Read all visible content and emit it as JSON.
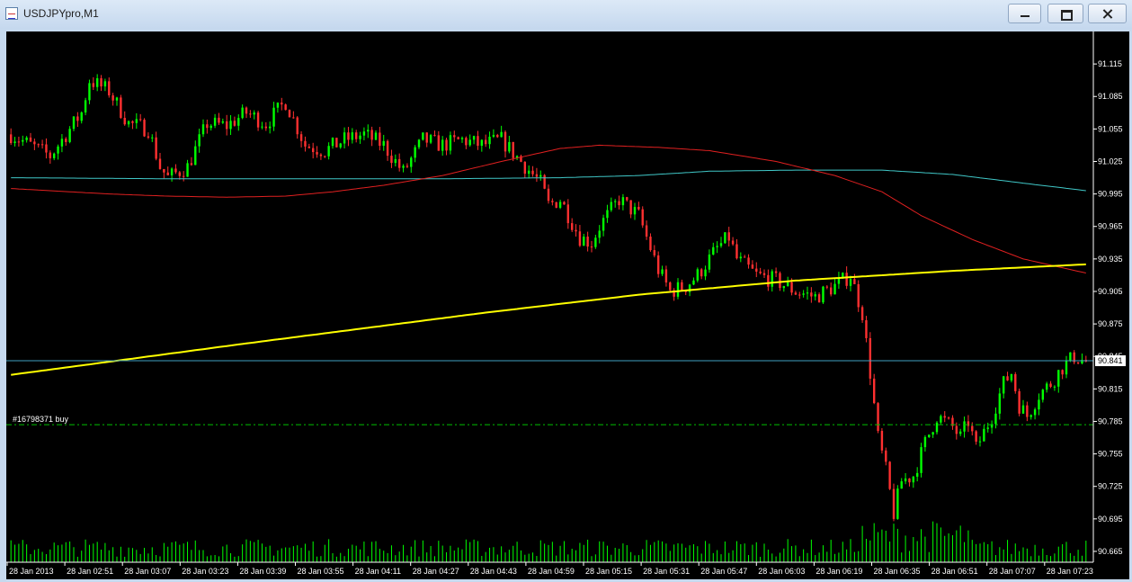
{
  "window": {
    "title": "USDJPYpro,M1",
    "minimize": "minimize",
    "maximize": "maximize",
    "close": "close"
  },
  "colors": {
    "background": "#000000",
    "bull_candle": "#00ff00",
    "bear_candle": "#ff3030",
    "ma_red": "#e02020",
    "ma_cyan": "#40c8c8",
    "ma_yellow": "#ffff00",
    "bid_line": "#3f9fbf",
    "order_line": "#00c000"
  },
  "chart_data": {
    "type": "candlestick",
    "symbol": "USDJPYpro",
    "timeframe": "M1",
    "ylim": [
      90.655,
      91.145
    ],
    "y_ticks": [
      "91.115",
      "91.085",
      "91.055",
      "91.025",
      "90.995",
      "90.965",
      "90.935",
      "90.905",
      "90.875",
      "90.845",
      "90.815",
      "90.785",
      "90.755",
      "90.725",
      "90.695",
      "90.665"
    ],
    "x_labels": [
      "28 Jan 2013",
      "28 Jan 02:51",
      "28 Jan 03:07",
      "28 Jan 03:23",
      "28 Jan 03:39",
      "28 Jan 03:55",
      "28 Jan 04:11",
      "28 Jan 04:27",
      "28 Jan 04:43",
      "28 Jan 04:59",
      "28 Jan 05:15",
      "28 Jan 05:31",
      "28 Jan 05:47",
      "28 Jan 06:03",
      "28 Jan 06:19",
      "28 Jan 06:35",
      "28 Jan 06:51",
      "28 Jan 07:07",
      "28 Jan 07:23"
    ],
    "current_price": "90.841",
    "current_price_value": 90.841,
    "order": {
      "label": "#16798371 buy",
      "price": 90.782
    },
    "close_path": [
      [
        0,
        91.05
      ],
      [
        10,
        91.03
      ],
      [
        18,
        91.07
      ],
      [
        20,
        91.1
      ],
      [
        25,
        91.09
      ],
      [
        30,
        91.06
      ],
      [
        35,
        91.055
      ],
      [
        38,
        91.02
      ],
      [
        40,
        91.01
      ],
      [
        45,
        91.02
      ],
      [
        50,
        91.06
      ],
      [
        55,
        91.058
      ],
      [
        60,
        91.07
      ],
      [
        65,
        91.06
      ],
      [
        70,
        91.08
      ],
      [
        75,
        91.04
      ],
      [
        80,
        91.035
      ],
      [
        85,
        91.045
      ],
      [
        90,
        91.05
      ],
      [
        95,
        91.04
      ],
      [
        100,
        91.015
      ],
      [
        105,
        91.045
      ],
      [
        110,
        91.04
      ],
      [
        115,
        91.045
      ],
      [
        120,
        91.04
      ],
      [
        125,
        91.045
      ],
      [
        130,
        91.025
      ],
      [
        135,
        91.005
      ],
      [
        137,
        90.985
      ],
      [
        140,
        90.99
      ],
      [
        145,
        90.955
      ],
      [
        148,
        90.95
      ],
      [
        150,
        90.965
      ],
      [
        155,
        90.99
      ],
      [
        160,
        90.975
      ],
      [
        165,
        90.925
      ],
      [
        168,
        90.905
      ],
      [
        172,
        90.91
      ],
      [
        175,
        90.92
      ],
      [
        180,
        90.945
      ],
      [
        183,
        90.955
      ],
      [
        185,
        90.935
      ],
      [
        190,
        90.92
      ],
      [
        195,
        90.915
      ],
      [
        200,
        90.905
      ],
      [
        205,
        90.9
      ],
      [
        210,
        90.91
      ],
      [
        214,
        90.92
      ],
      [
        217,
        90.885
      ],
      [
        219,
        90.83
      ],
      [
        221,
        90.77
      ],
      [
        223,
        90.74
      ],
      [
        225,
        90.7
      ],
      [
        227,
        90.73
      ],
      [
        230,
        90.735
      ],
      [
        233,
        90.765
      ],
      [
        236,
        90.79
      ],
      [
        240,
        90.78
      ],
      [
        242,
        90.77
      ],
      [
        244,
        90.785
      ],
      [
        246,
        90.76
      ],
      [
        250,
        90.79
      ],
      [
        253,
        90.82
      ],
      [
        255,
        90.83
      ],
      [
        257,
        90.8
      ],
      [
        259,
        90.79
      ],
      [
        262,
        90.81
      ],
      [
        265,
        90.82
      ],
      [
        268,
        90.835
      ],
      [
        271,
        90.845
      ],
      [
        274,
        90.84
      ]
    ],
    "ma_red": [
      [
        0,
        91.0
      ],
      [
        25,
        90.995
      ],
      [
        40,
        90.993
      ],
      [
        55,
        90.992
      ],
      [
        70,
        90.993
      ],
      [
        82,
        90.997
      ],
      [
        95,
        91.003
      ],
      [
        110,
        91.012
      ],
      [
        125,
        91.025
      ],
      [
        140,
        91.037
      ],
      [
        150,
        91.04
      ],
      [
        165,
        91.038
      ],
      [
        178,
        91.035
      ],
      [
        195,
        91.025
      ],
      [
        210,
        91.012
      ],
      [
        222,
        90.997
      ],
      [
        232,
        90.975
      ],
      [
        245,
        90.953
      ],
      [
        258,
        90.935
      ],
      [
        274,
        90.922
      ]
    ],
    "ma_cyan": [
      [
        0,
        91.01
      ],
      [
        40,
        91.009
      ],
      [
        80,
        91.009
      ],
      [
        110,
        91.009
      ],
      [
        140,
        91.01
      ],
      [
        160,
        91.012
      ],
      [
        178,
        91.016
      ],
      [
        200,
        91.017
      ],
      [
        222,
        91.017
      ],
      [
        240,
        91.013
      ],
      [
        258,
        91.005
      ],
      [
        274,
        90.998
      ]
    ],
    "ma_yellow": [
      [
        0,
        90.828
      ],
      [
        60,
        90.857
      ],
      [
        120,
        90.885
      ],
      [
        160,
        90.902
      ],
      [
        200,
        90.915
      ],
      [
        240,
        90.924
      ],
      [
        274,
        90.93
      ]
    ]
  }
}
